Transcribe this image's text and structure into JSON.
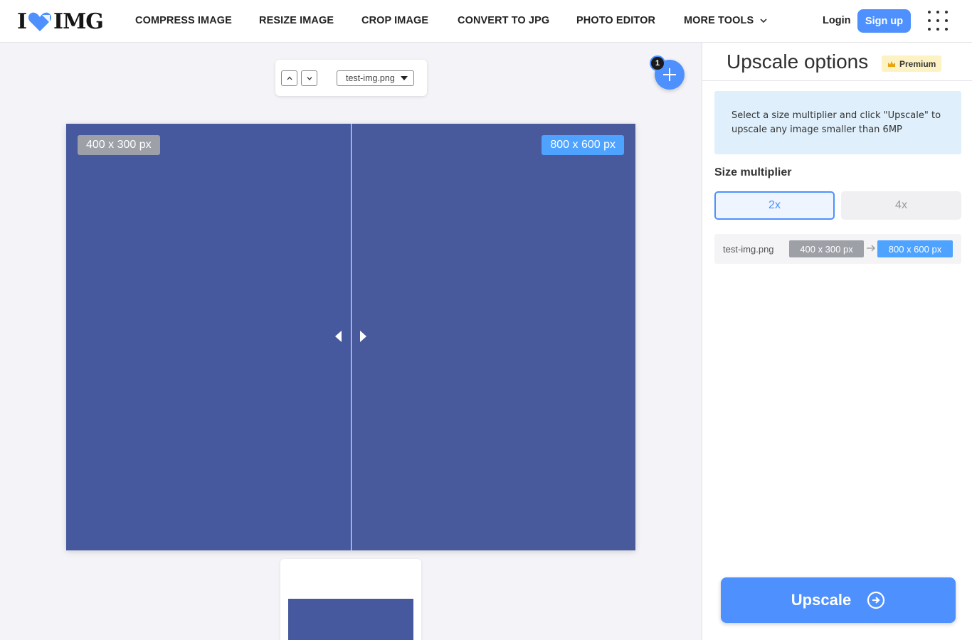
{
  "header": {
    "logo_left": "I",
    "logo_right": "IMG",
    "nav": [
      "COMPRESS IMAGE",
      "RESIZE IMAGE",
      "CROP IMAGE",
      "CONVERT TO JPG",
      "PHOTO EDITOR",
      "MORE TOOLS"
    ],
    "login": "Login",
    "signup": "Sign up"
  },
  "toolbar": {
    "selected_file": "test-img.png"
  },
  "add_files": {
    "count": "1"
  },
  "preview": {
    "original_size": "400 x 300 px",
    "upscaled_size": "800 x 600 px"
  },
  "panel": {
    "title": "Upscale options",
    "premium_label": "Premium",
    "info": "Select a size multiplier and click \"Upscale\" to upscale any image smaller than 6MP",
    "size_multiplier_label": "Size multiplier",
    "multipliers": [
      "2x",
      "4x"
    ],
    "selected_multiplier": "2x",
    "file_name": "test-img.png",
    "file_old_size": "400 x 300 px",
    "file_new_size": "800 x 600 px",
    "upscale_button": "Upscale"
  },
  "colors": {
    "accent": "#4d90fe",
    "image_fill": "#46599e",
    "badge_original": "#9ea0a8",
    "badge_upscaled": "#4da3ff",
    "info_bg": "#dff0fc",
    "premium_bg": "#fdf2c4"
  },
  "icons": {
    "logo_heart": "heart-icon",
    "more_tools": "chevron-down-icon",
    "apps": "grid-icon",
    "move_up": "chevron-up-icon",
    "move_down": "chevron-down-icon",
    "add": "plus-icon",
    "premium": "crown-icon",
    "size_arrow": "arrow-right-icon",
    "upscale": "circle-arrow-right-icon"
  }
}
